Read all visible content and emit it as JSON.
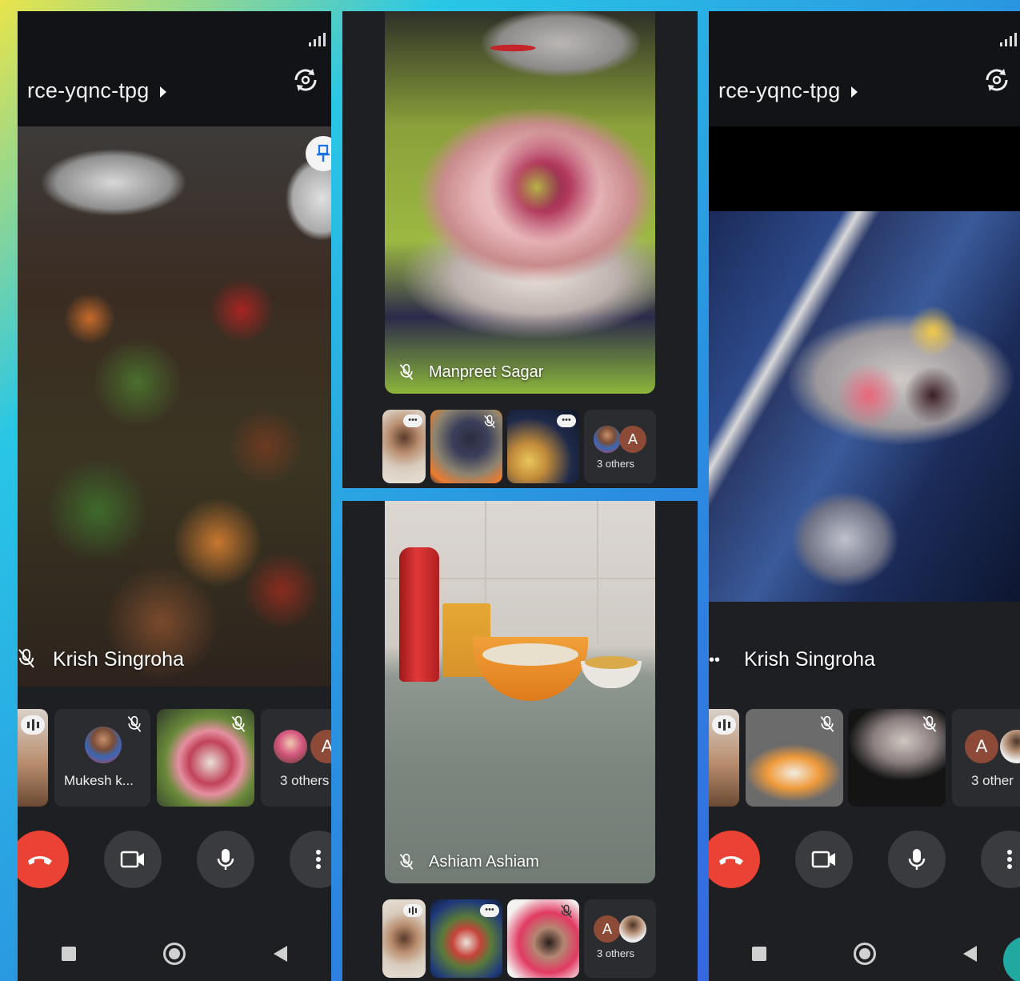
{
  "colors": {
    "end_call": "#ea4335",
    "avatar_bg": "#8d4a37",
    "tile_bg": "#2b2c30",
    "topbar_bg": "#121316"
  },
  "left_phone": {
    "meeting_code": "rce-yqnc-tpg",
    "speaker_name": "Krish Singroha",
    "thumbnails": [
      {
        "name": "Mukesh k..."
      }
    ],
    "others_label": "3 others",
    "others_avatar_letter": "A"
  },
  "middle_top": {
    "speaker_name": "Manpreet Sagar",
    "others_label": "3 others",
    "others_avatar_letter": "A"
  },
  "middle_bottom": {
    "speaker_name": "Ashiam Ashiam",
    "others_label": "3 others",
    "others_avatar_letter": "A"
  },
  "right_phone": {
    "meeting_code": "rce-yqnc-tpg",
    "speaker_name": "Krish Singroha",
    "others_label": "3 other",
    "others_avatar_letter": "A"
  },
  "icons": [
    "signal-icon",
    "play-arrow-icon",
    "switch-camera-icon",
    "pin-icon",
    "mic-off-icon",
    "end-call-icon",
    "video-camera-icon",
    "microphone-icon",
    "more-vert-icon",
    "nav-square-icon",
    "nav-home-icon",
    "nav-back-icon",
    "more-dots-icon",
    "audio-level-icon"
  ]
}
